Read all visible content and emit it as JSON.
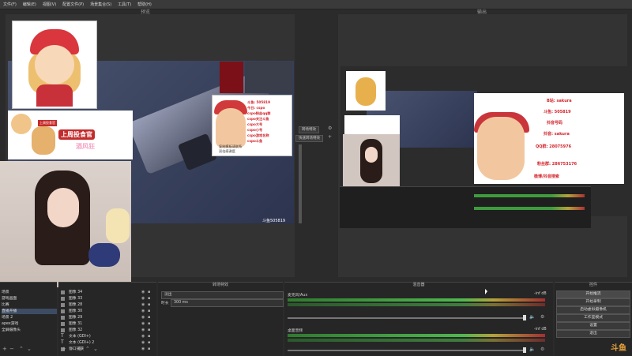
{
  "menu": [
    "文件(F)",
    "编辑(E)",
    "视图(V)",
    "配置文件(P)",
    "场景集合(S)",
    "工具(T)",
    "帮助(H)"
  ],
  "preview_title": "预览",
  "program_title": "输出",
  "overlay": {
    "banner_title": "上周投食官",
    "banner_sub": "酒风狂",
    "banner_tag": "上周投食官",
    "info_lines": [
      "斗鱼: 505819",
      "今日: cspo",
      "cspo粉丝qq群",
      "cspo关注斗鱼",
      "cspo大号",
      "cspo小号",
      "cspo游戏名称",
      "cspo斗鱼"
    ],
    "info_caption": "复制模板请联系",
    "info_caption2": "双倍感谢度",
    "watermark": "斗鱼505819"
  },
  "transition": {
    "btn1": "转场特效",
    "btn2": "快速转场特效"
  },
  "program_overlay": [
    "B站: sakura",
    "斗鱼: 505819",
    "抖音号码",
    "抖音: sakura",
    "QQ群: 28075976",
    "粉丝群: 286753176",
    "微博/抖音搜索"
  ],
  "docks": {
    "scenes_title": "场景",
    "sources_title": "来源",
    "transitions_title": "转场特效",
    "mixer_title": "混音器",
    "controls_title": "控件"
  },
  "scenes": [
    "场景",
    "游戏画面",
    "比赛",
    "直播开播",
    "场景 2",
    "apex游戏",
    "全屏摄像头"
  ],
  "scene_selected_index": 3,
  "sources": [
    "图像 34",
    "图像 33",
    "图像 28",
    "图像 30",
    "图像 29",
    "图像 31",
    "图像 32",
    "文本 (GDI+)",
    "文本 (GDI+) 2",
    "窗口捕获"
  ],
  "transition_panel": {
    "type": "淡出",
    "duration_label": "时长",
    "duration_value": "300 ms"
  },
  "mixer": [
    {
      "name": "麦克风/Aux",
      "db": "-inf dB"
    },
    {
      "name": "桌面音频",
      "db": "-inf dB"
    }
  ],
  "controls": [
    "开始推流",
    "开始录制",
    "启动虚拟摄像机",
    "工作室模式",
    "设置",
    "退出"
  ],
  "logo": "斗鱼"
}
